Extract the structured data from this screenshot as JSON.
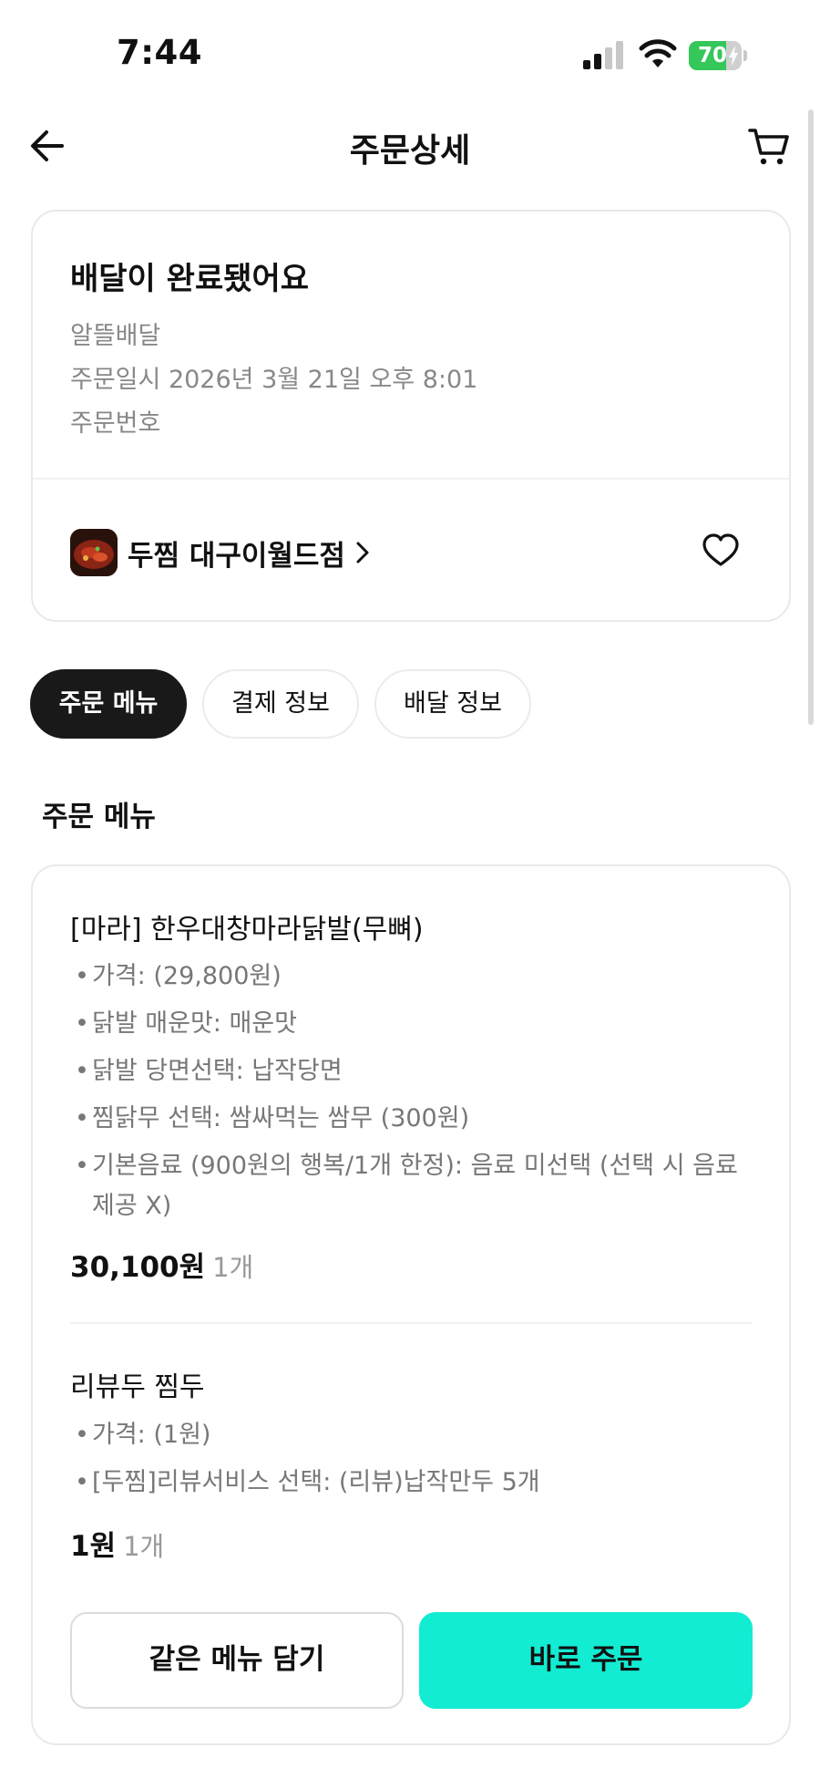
{
  "status_bar": {
    "time": "7:44",
    "battery": "70",
    "battery_level": 0.7
  },
  "header": {
    "title": "주문상세"
  },
  "order": {
    "status_title": "배달이 완료됐어요",
    "delivery_type": "알뜰배달",
    "order_date": "주문일시 2026년 3월 21일 오후 8:01",
    "order_number_label": "주문번호",
    "store_name": "두찜 대구이월드점"
  },
  "tabs": [
    {
      "label": "주문 메뉴",
      "active": true
    },
    {
      "label": "결제 정보",
      "active": false
    },
    {
      "label": "배달 정보",
      "active": false
    }
  ],
  "section_title": "주문 메뉴",
  "items": [
    {
      "name": "[마라] 한우대창마라닭발(무뼈)",
      "options": [
        "가격:  (29,800원)",
        "닭발 매운맛: 매운맛",
        "닭발 당면선택: 납작당면",
        "찜닭무 선택: 쌈싸먹는 쌈무 (300원)",
        "기본음료 (900원의 행복/1개 한정): 음료 미선택 (선택 시 음료 제공 X)"
      ],
      "price": "30,100원",
      "qty": "1개"
    },
    {
      "name": "리뷰두 찜두",
      "options": [
        "가격:  (1원)",
        "[두찜]리뷰서비스 선택: (리뷰)납작만두 5개"
      ],
      "price": "1원",
      "qty": "1개"
    }
  ],
  "actions": {
    "add_same": "같은 메뉴 담기",
    "order_now": "바로 주문"
  },
  "colors": {
    "accent": "#12ecd2",
    "active_pill": "#191919",
    "battery_green": "#34c759"
  }
}
